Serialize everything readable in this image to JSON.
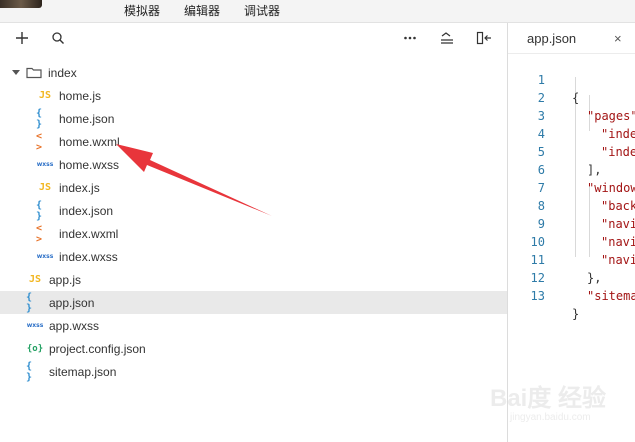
{
  "menu": {
    "items": [
      "模拟器",
      "编辑器",
      "调试器"
    ]
  },
  "explorer": {
    "toolbar": {
      "add_icon": "plus-icon",
      "search_icon": "search-icon",
      "more_icon": "ellipsis-icon",
      "collapse_icon": "collapse-icon",
      "layout_icon": "panel-toggle-icon"
    },
    "folder": {
      "name": "index",
      "expanded": true
    },
    "index_files": [
      {
        "name": "home.js",
        "type": "js",
        "badge": "JS"
      },
      {
        "name": "home.json",
        "type": "json",
        "badge": "{ }"
      },
      {
        "name": "home.wxml",
        "type": "wxml",
        "badge": "< >"
      },
      {
        "name": "home.wxss",
        "type": "wxss",
        "badge": "wxss"
      },
      {
        "name": "index.js",
        "type": "js",
        "badge": "JS"
      },
      {
        "name": "index.json",
        "type": "json",
        "badge": "{ }"
      },
      {
        "name": "index.wxml",
        "type": "wxml",
        "badge": "< >"
      },
      {
        "name": "index.wxss",
        "type": "wxss",
        "badge": "wxss"
      }
    ],
    "root_files": [
      {
        "name": "app.js",
        "type": "js",
        "badge": "JS"
      },
      {
        "name": "app.json",
        "type": "json",
        "badge": "{ }",
        "selected": true
      },
      {
        "name": "app.wxss",
        "type": "wxss",
        "badge": "wxss"
      },
      {
        "name": "project.config.json",
        "type": "config",
        "badge": "{o}"
      },
      {
        "name": "sitemap.json",
        "type": "json",
        "badge": "{ }"
      }
    ]
  },
  "editor": {
    "tab_title": "app.json",
    "close_glyph": "×",
    "lines": [
      {
        "n": "1",
        "indent": 0,
        "text": "{"
      },
      {
        "n": "2",
        "indent": 1,
        "text": "\"pages\""
      },
      {
        "n": "3",
        "indent": 2,
        "text": "\"inde"
      },
      {
        "n": "4",
        "indent": 2,
        "text": "\"inde"
      },
      {
        "n": "5",
        "indent": 1,
        "text": "],"
      },
      {
        "n": "6",
        "indent": 1,
        "text": "\"window"
      },
      {
        "n": "7",
        "indent": 2,
        "text": "\"back"
      },
      {
        "n": "8",
        "indent": 2,
        "text": "\"navi"
      },
      {
        "n": "9",
        "indent": 2,
        "text": "\"navi"
      },
      {
        "n": "10",
        "indent": 2,
        "text": "\"navi"
      },
      {
        "n": "11",
        "indent": 1,
        "text": "},"
      },
      {
        "n": "12",
        "indent": 1,
        "text": "\"sitema"
      },
      {
        "n": "13",
        "indent": 0,
        "text": "}"
      }
    ]
  },
  "watermark": {
    "main": "Bai度 经验",
    "sub": "jingyan.baidu.com"
  },
  "colors": {
    "arrow": "#e8353b",
    "selected_row": "#e9e9e9",
    "js": "#f2b620",
    "json": "#2f8ecf",
    "wxml": "#e8742b",
    "wxss": "#2f72c8",
    "config": "#22a062"
  }
}
